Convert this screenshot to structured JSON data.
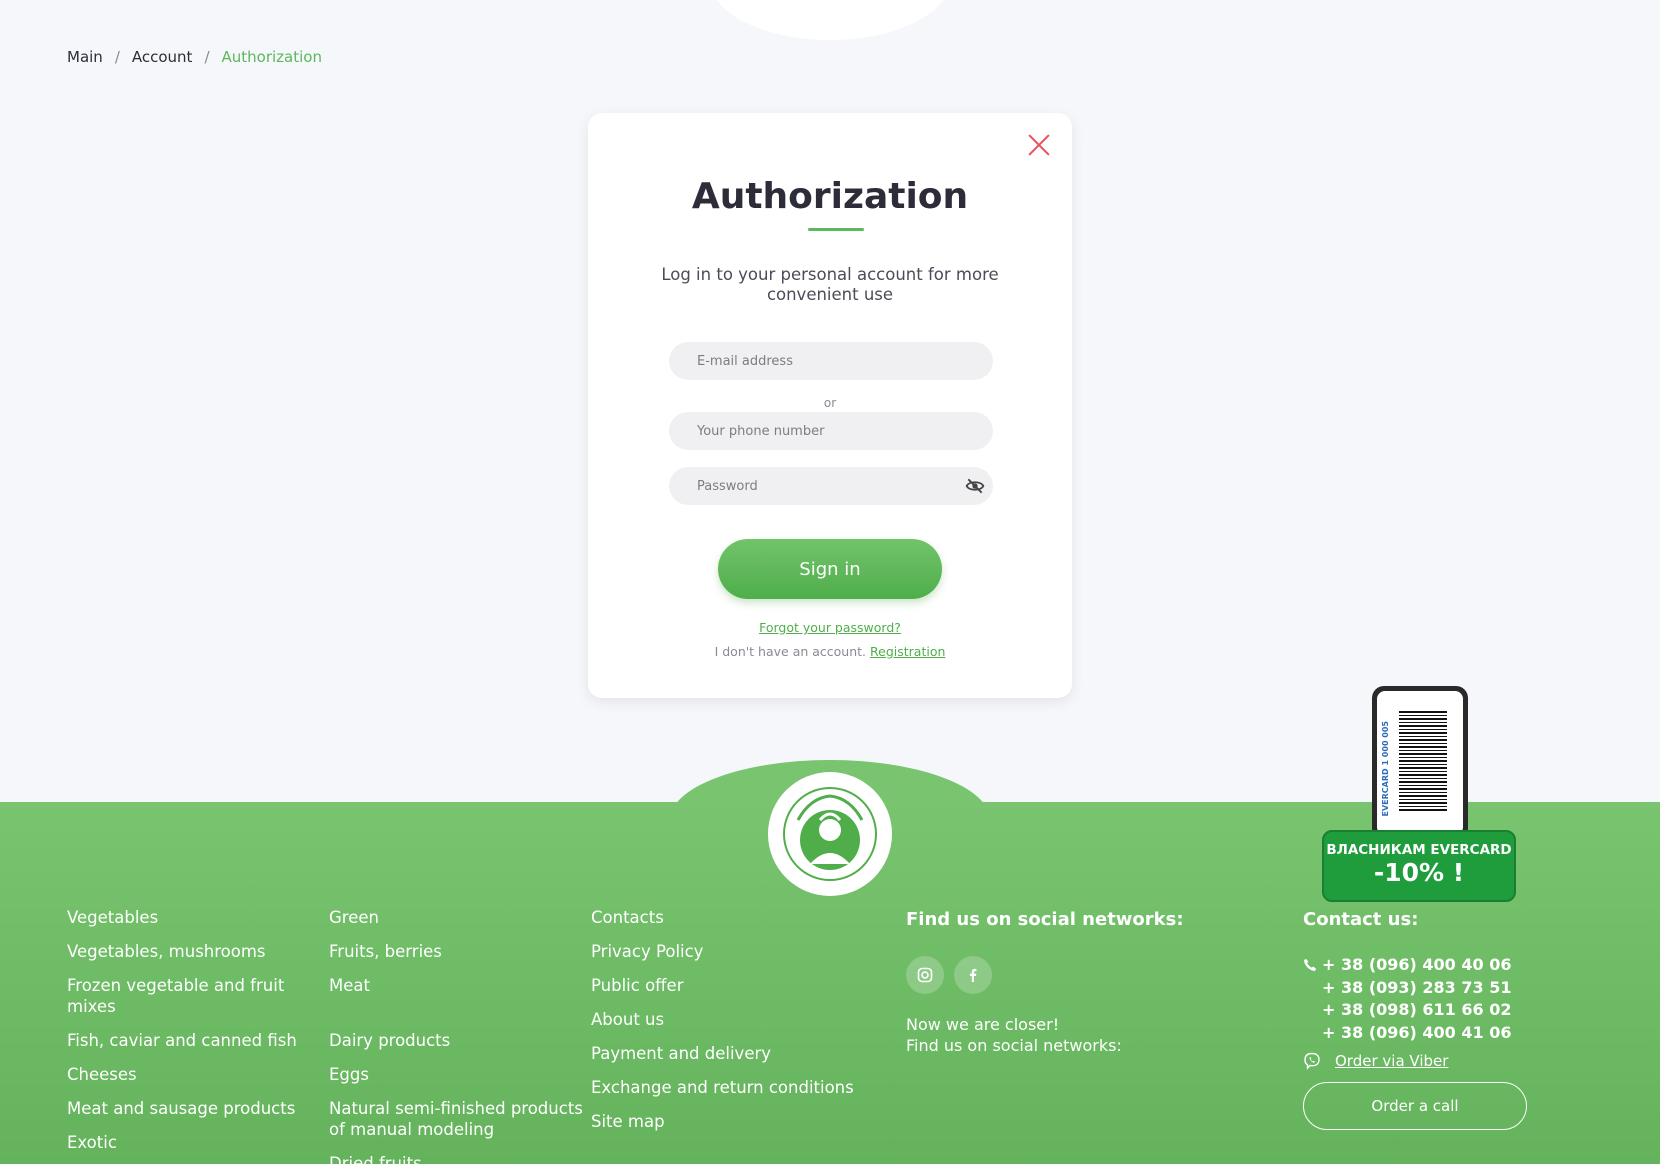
{
  "breadcrumb": {
    "items": [
      "Main",
      "Account"
    ],
    "current": "Authorization",
    "separator": "/"
  },
  "modal": {
    "title": "Authorization",
    "subtitle": "Log in to your personal account for more convenient use",
    "email_placeholder": "E-mail address",
    "or_text": "or",
    "phone_placeholder": "Your phone number",
    "password_placeholder": "Password",
    "signin_label": "Sign in",
    "forgot_label": "Forgot your password?",
    "no_account_text": "I don't have an account.",
    "registration_label": "Registration"
  },
  "footer": {
    "col1": [
      "Vegetables",
      "Vegetables, mushrooms",
      "Frozen vegetable and fruit mixes",
      "Fish, caviar and canned fish",
      "Cheeses",
      "Meat and sausage products",
      "Exotic"
    ],
    "col2": [
      "Green",
      "Fruits, berries",
      "Meat",
      "Dairy products",
      "Eggs",
      "Natural semi-finished products of manual modeling",
      "Dried fruits"
    ],
    "col3": [
      "Contacts",
      "Privacy Policy",
      "Public offer",
      "About us",
      "Payment and delivery",
      "Exchange and return conditions",
      "Site map"
    ],
    "social": {
      "title": "Find us on social networks:",
      "icons": [
        "instagram-icon",
        "facebook-icon"
      ],
      "text_line1": "Now we are closer!",
      "text_line2": "Find us on social networks:"
    },
    "contact": {
      "title": "Contact us:",
      "phones": [
        "+ 38 (096) 400 40 06",
        "+ 38 (093) 283 73 51",
        "+ 38 (098) 611 66 02",
        "+ 38 (096) 400 41 06"
      ],
      "viber_label": "Order via Viber",
      "order_call_label": "Order a call"
    }
  },
  "promo": {
    "line1": "ВЛАСНИКАМ EVERCARD",
    "line2": "-10% !",
    "card_text": "EVERCARD 1 000 005"
  },
  "colors": {
    "accent": "#5cb85c",
    "footer_green": "#6bb863",
    "close_red": "#e8505b",
    "promo_green": "#1f9c3c"
  }
}
